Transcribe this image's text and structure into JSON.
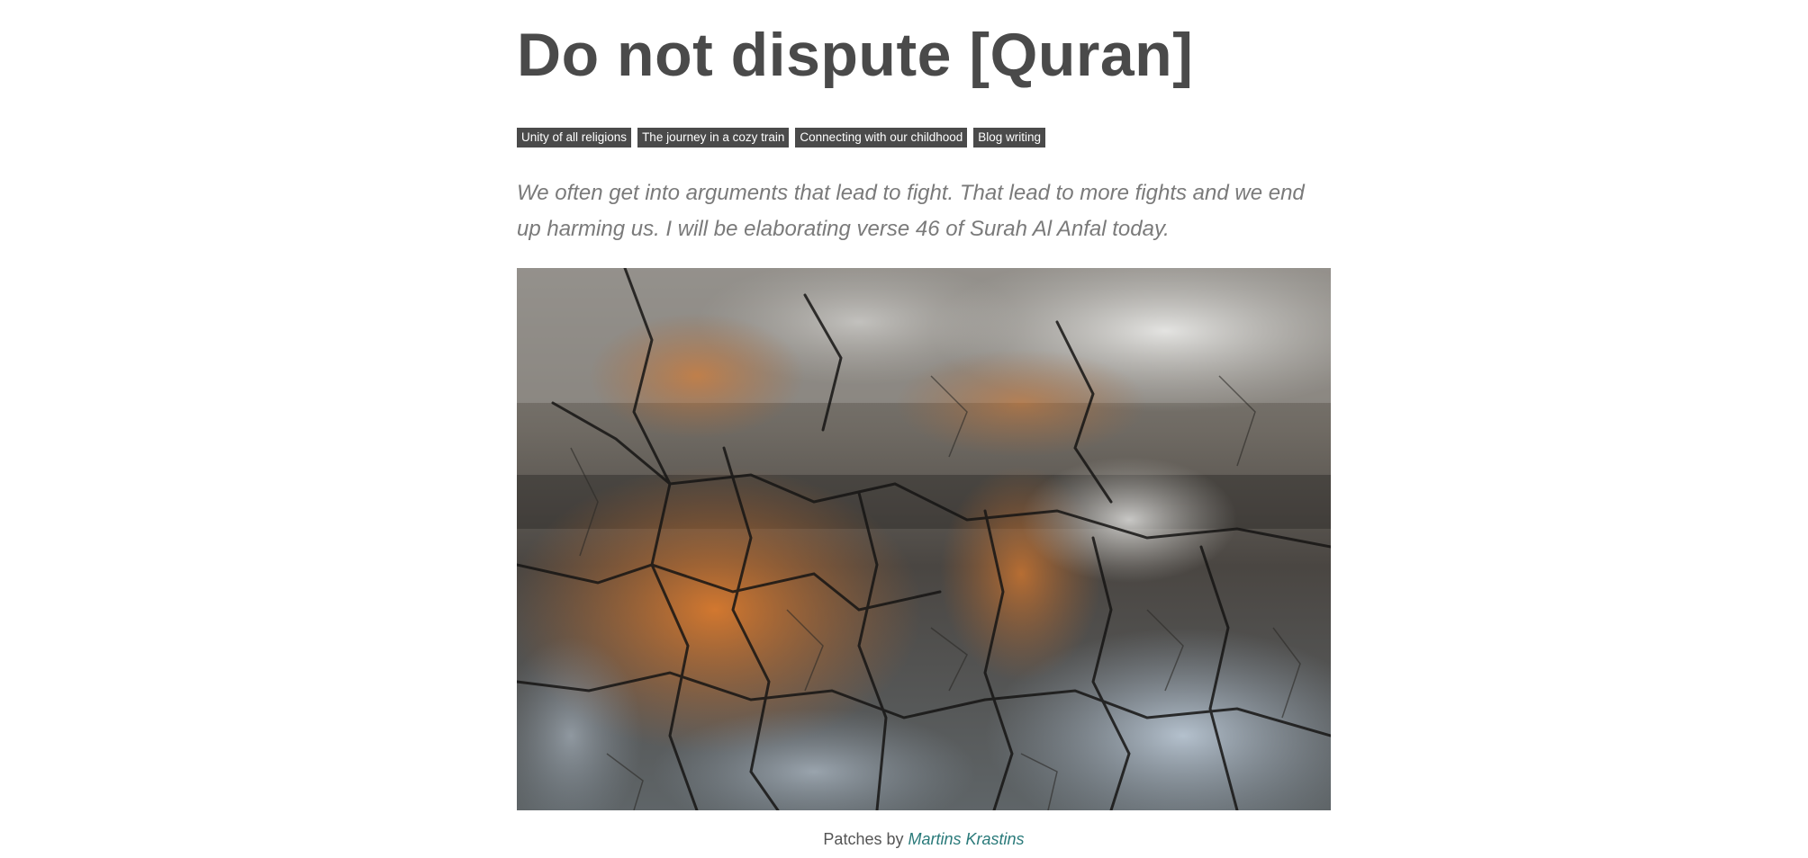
{
  "article": {
    "title": "Do not dispute [Quran]",
    "tags": [
      "Unity of all religions",
      "The journey in a cozy train",
      "Connecting with our childhood",
      "Blog writing"
    ],
    "lead": "We often get into arguments that lead to fight. That lead to more fights and we end up harming us. I will be elaborating verse 46 of Surah Al Anfal today.",
    "image": {
      "caption_prefix": "Patches",
      "caption_by": "by",
      "caption_author": "Martins Krastins"
    }
  },
  "colors": {
    "text": "#4a4a4a",
    "tag_bg": "#4a4a4a",
    "tag_text": "#ffffff",
    "lead": "#7a7a7a",
    "caption_link": "#2a7a7a"
  }
}
